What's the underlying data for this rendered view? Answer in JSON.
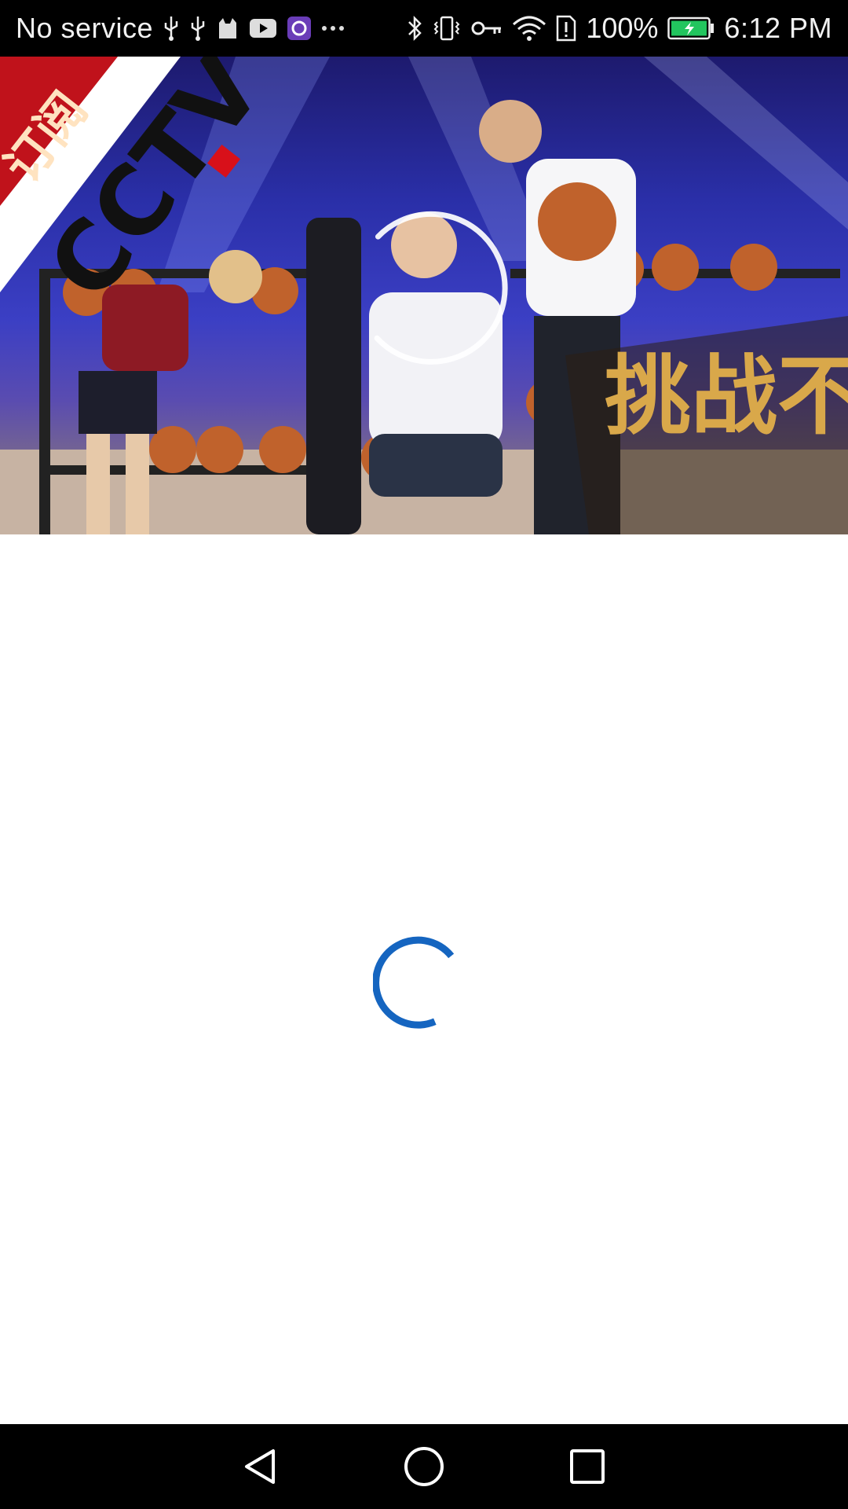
{
  "status_bar": {
    "carrier": "No service",
    "icons_left": [
      "usb-icon",
      "usb-icon",
      "cat-app-icon",
      "youtube-icon",
      "app-icon",
      "more-dots-icon"
    ],
    "icons_right": [
      "bluetooth-icon",
      "vibrate-icon",
      "vpn-key-icon",
      "wifi-icon",
      "sim-alert-icon"
    ],
    "battery_percent": "100%",
    "time": "6:12 PM",
    "battery_color": "#22c55e"
  },
  "video": {
    "logo_text": "CCTV",
    "ribbon_text": "订阅",
    "show_title": "挑战不可能",
    "loading": true,
    "spinner_color": "#ffffff"
  },
  "content": {
    "loading": true,
    "spinner_color": "#1565c0"
  },
  "nav_bar": {
    "buttons": [
      "back-icon",
      "home-icon",
      "recents-icon"
    ]
  }
}
